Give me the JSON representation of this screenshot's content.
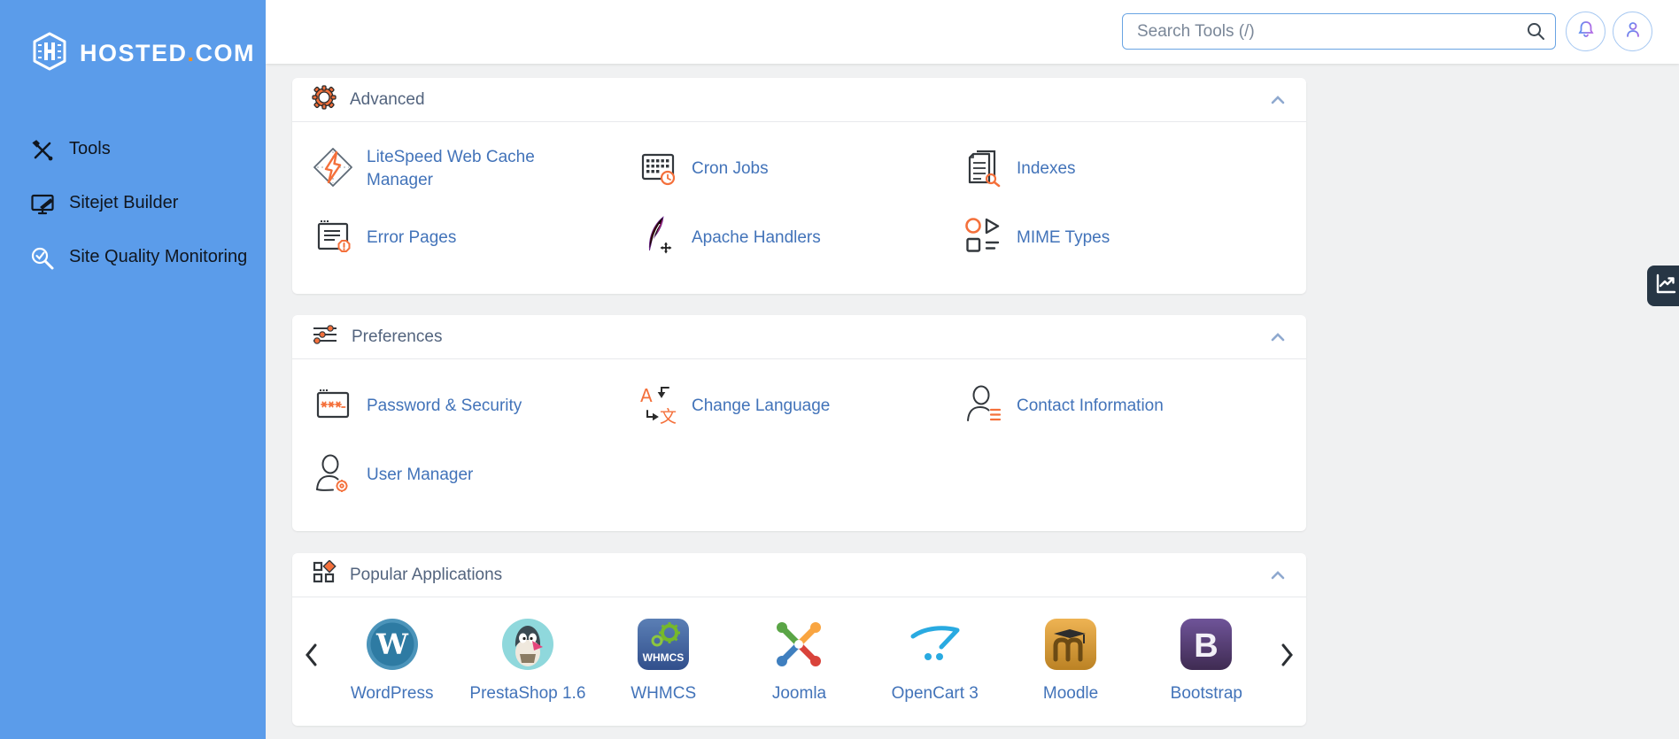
{
  "logo": {
    "name": "HOSTED",
    "dot": ".",
    "tld": "COM"
  },
  "sidebar": {
    "items": [
      {
        "label": "Tools",
        "icon": "tools-icon"
      },
      {
        "label": "Sitejet Builder",
        "icon": "monitor-pen-icon"
      },
      {
        "label": "Site Quality Monitoring",
        "icon": "magnifier-check-icon"
      }
    ]
  },
  "header": {
    "search_placeholder": "Search Tools (/)",
    "icons": [
      "search-icon",
      "bell-icon",
      "user-icon"
    ]
  },
  "sections": [
    {
      "title": "Advanced",
      "icon": "gear-icon",
      "items": [
        {
          "label": "LiteSpeed Web Cache Manager",
          "icon": "litespeed-icon"
        },
        {
          "label": "Cron Jobs",
          "icon": "cron-jobs-icon"
        },
        {
          "label": "Indexes",
          "icon": "indexes-icon"
        },
        {
          "label": "Error Pages",
          "icon": "error-pages-icon"
        },
        {
          "label": "Apache Handlers",
          "icon": "apache-feather-icon"
        },
        {
          "label": "MIME Types",
          "icon": "mime-types-icon"
        }
      ]
    },
    {
      "title": "Preferences",
      "icon": "sliders-icon",
      "items": [
        {
          "label": "Password & Security",
          "icon": "password-icon"
        },
        {
          "label": "Change Language",
          "icon": "language-icon"
        },
        {
          "label": "Contact Information",
          "icon": "contact-icon"
        },
        {
          "label": "User Manager",
          "icon": "user-manager-icon"
        }
      ]
    },
    {
      "title": "Popular Applications",
      "icon": "apps-grid-icon",
      "apps": [
        {
          "label": "WordPress",
          "icon": "wordpress-icon"
        },
        {
          "label": "PrestaShop 1.6",
          "icon": "prestashop-icon"
        },
        {
          "label": "WHMCS",
          "icon": "whmcs-icon"
        },
        {
          "label": "Joomla",
          "icon": "joomla-icon"
        },
        {
          "label": "OpenCart 3",
          "icon": "opencart-icon"
        },
        {
          "label": "Moodle",
          "icon": "moodle-icon"
        },
        {
          "label": "Bootstrap",
          "icon": "bootstrap-icon"
        }
      ]
    }
  ],
  "colors": {
    "sidebar_blue": "#5b9cea",
    "accent_orange": "#f4703b",
    "link_blue": "#4273b9",
    "section_title": "#53647e",
    "content_bg": "#f0f1f2",
    "stats_tab_bg": "#273645"
  }
}
